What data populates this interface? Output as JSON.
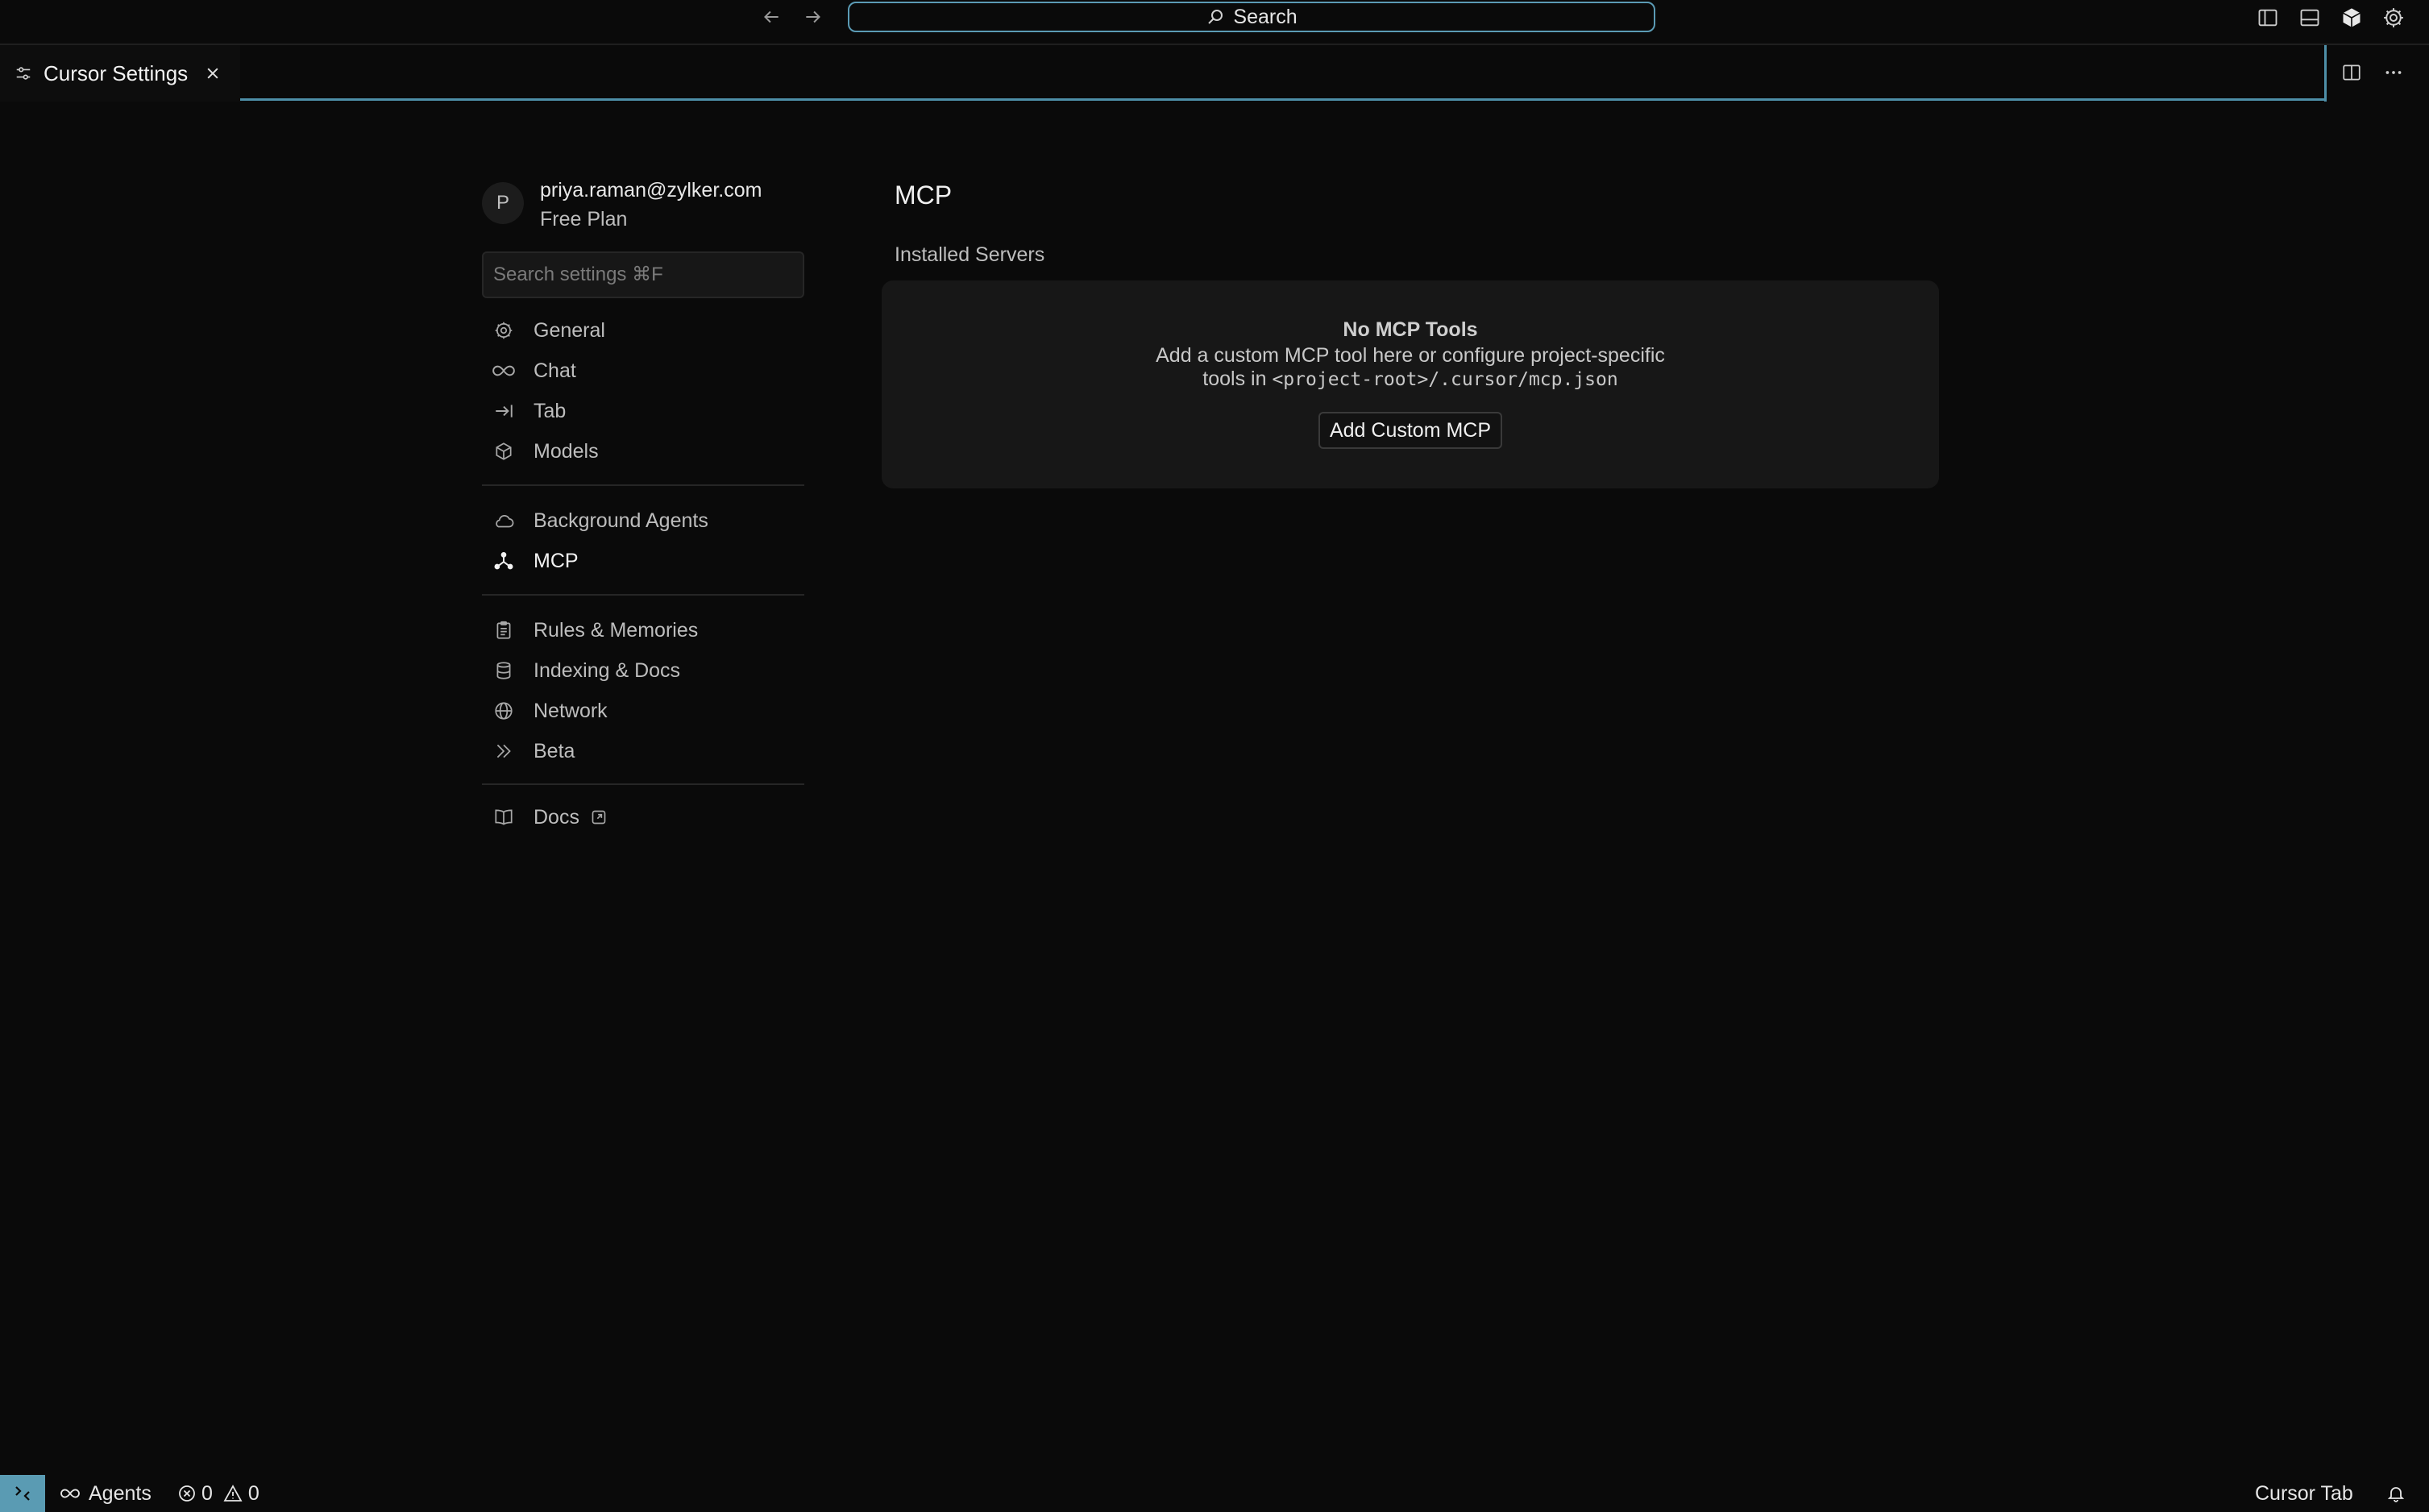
{
  "titlebar": {
    "search_label": "Search"
  },
  "tab": {
    "label": "Cursor Settings"
  },
  "account": {
    "avatar_letter": "P",
    "email": "priya.raman@zylker.com",
    "plan": "Free Plan"
  },
  "sidebar": {
    "search_placeholder": "Search settings ⌘F",
    "groups": [
      [
        {
          "label": "General",
          "icon": "gear-icon"
        },
        {
          "label": "Chat",
          "icon": "infinity-icon"
        },
        {
          "label": "Tab",
          "icon": "arrow-right-bar-icon"
        },
        {
          "label": "Models",
          "icon": "cube-icon"
        }
      ],
      [
        {
          "label": "Background Agents",
          "icon": "cloud-icon"
        },
        {
          "label": "MCP",
          "icon": "mcp-nodes-icon",
          "active": true
        }
      ],
      [
        {
          "label": "Rules & Memories",
          "icon": "clipboard-icon"
        },
        {
          "label": "Indexing & Docs",
          "icon": "database-icon"
        },
        {
          "label": "Network",
          "icon": "globe-icon"
        },
        {
          "label": "Beta",
          "icon": "double-chevron-icon"
        }
      ],
      [
        {
          "label": "Docs",
          "icon": "book-icon",
          "external": true
        }
      ]
    ]
  },
  "main": {
    "title": "MCP",
    "section_label": "Installed Servers",
    "empty_title": "No MCP Tools",
    "empty_line1": "Add a custom MCP tool here or configure project-specific",
    "empty_line2_prefix": "tools in ",
    "empty_line2_code": "<project-root>/.cursor/mcp.json",
    "add_button": "Add Custom MCP"
  },
  "statusbar": {
    "agents_label": "Agents",
    "errors": "0",
    "warnings": "0",
    "right_label": "Cursor Tab"
  },
  "colors": {
    "accent": "#5a9bb3",
    "background": "#0a0a0a",
    "panel": "#171717"
  }
}
